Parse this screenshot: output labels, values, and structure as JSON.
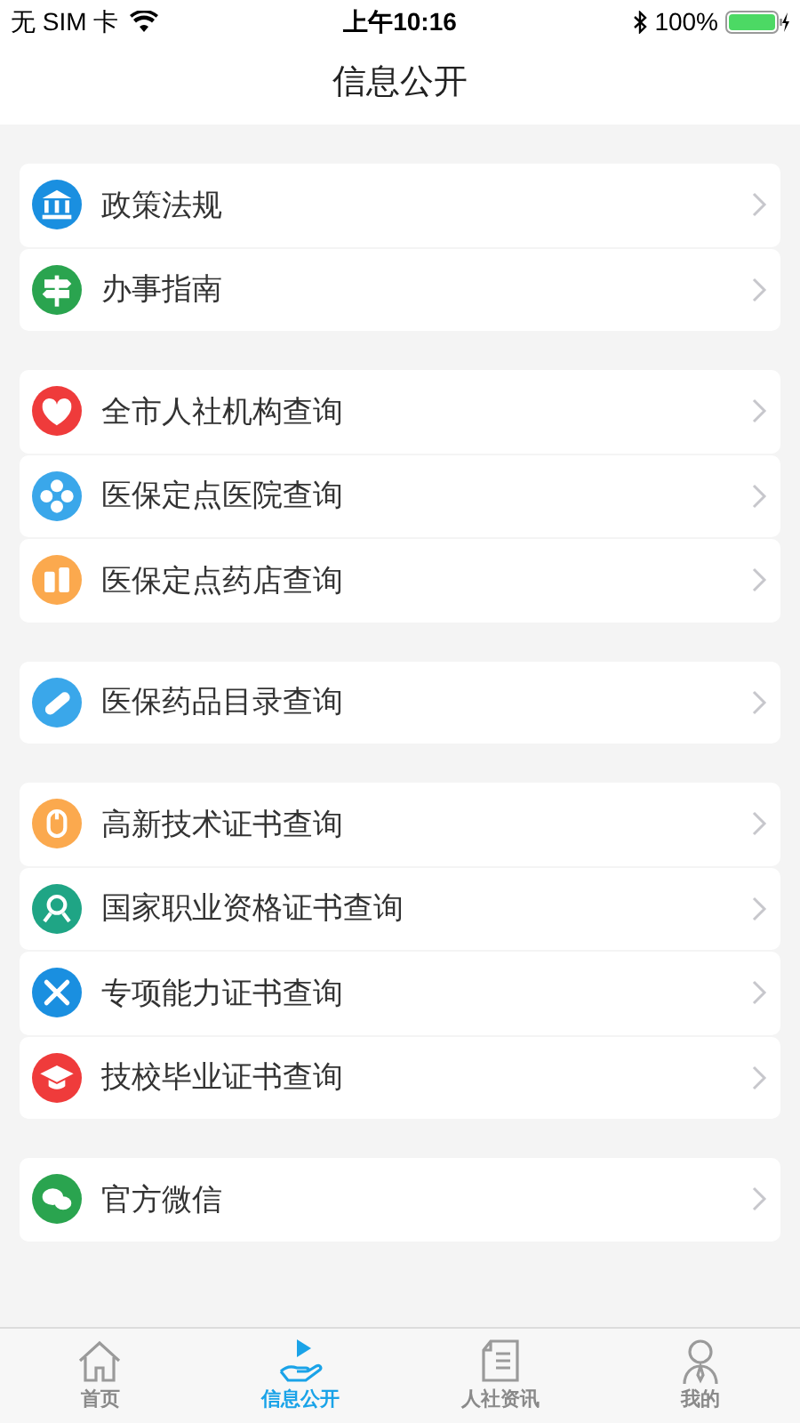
{
  "status_bar": {
    "carrier": "无 SIM 卡",
    "time": "上午10:16",
    "battery": "100%"
  },
  "title": "信息公开",
  "groups": [
    {
      "items": [
        {
          "label": "政策法规",
          "color": "#1a8fe0"
        },
        {
          "label": "办事指南",
          "color": "#2aa44f"
        }
      ]
    },
    {
      "items": [
        {
          "label": "全市人社机构查询",
          "color": "#ef3b3b"
        },
        {
          "label": "医保定点医院查询",
          "color": "#3aa7ea"
        },
        {
          "label": "医保定点药店查询",
          "color": "#fba94e"
        }
      ]
    },
    {
      "items": [
        {
          "label": "医保药品目录查询",
          "color": "#3aa7ea"
        }
      ]
    },
    {
      "items": [
        {
          "label": "高新技术证书查询",
          "color": "#fba94e"
        },
        {
          "label": "国家职业资格证书查询",
          "color": "#1fa585"
        },
        {
          "label": "专项能力证书查询",
          "color": "#1a8fe0"
        },
        {
          "label": "技校毕业证书查询",
          "color": "#ef3b3b"
        }
      ]
    },
    {
      "items": [
        {
          "label": "官方微信",
          "color": "#2aa44f"
        }
      ]
    }
  ],
  "tabs": [
    {
      "label": "首页",
      "selected": false
    },
    {
      "label": "信息公开",
      "selected": true
    },
    {
      "label": "人社资讯",
      "selected": false
    },
    {
      "label": "我的",
      "selected": false
    }
  ]
}
